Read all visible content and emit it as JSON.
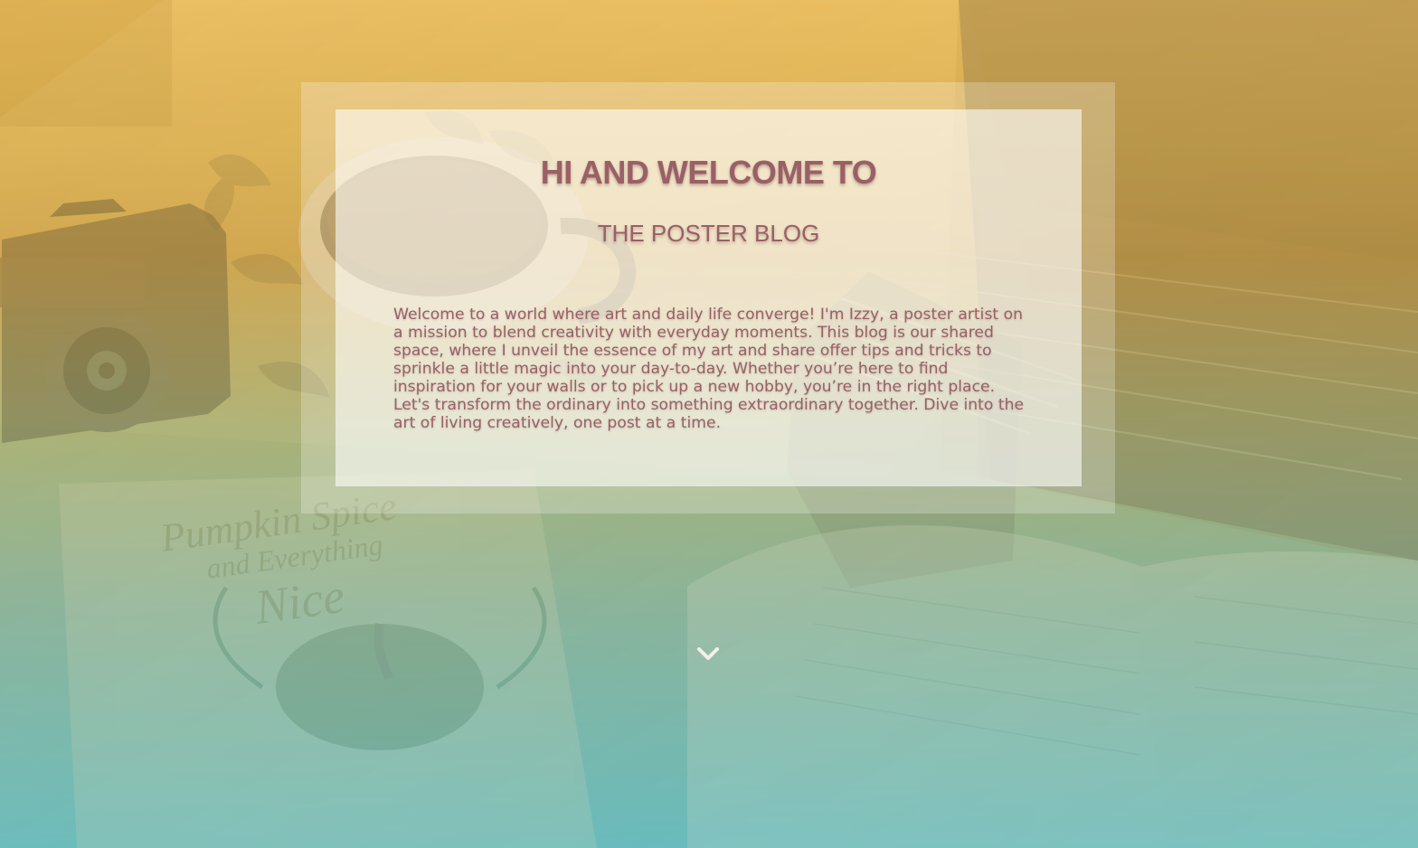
{
  "hero": {
    "heading": "HI AND WELCOME TO",
    "subheading": "THE POSTER BLOG",
    "intro_text": "Welcome to a world where art and daily life converge! I'm Izzy, a poster artist on a mission to blend creativity with everyday moments. This blog is our shared space, where I unveil the essence of my art and share offer tips and tricks to sprinkle a little magic into your day-to-day. Whether you’re here to find inspiration for your walls or to pick up a new hobby, you’re in the right place. Let's transform the ordinary into something extraordinary together. Dive into the art of living creatively, one post at a time.",
    "background_image_text": [
      "Pumpkin Spice",
      "and Everything",
      "Nice"
    ],
    "scroll_icon": "chevron-down-icon"
  },
  "colors": {
    "gradient_top": "#e7b54c",
    "gradient_middle": "#9fab6e",
    "gradient_bottom": "#5fb7b9",
    "text_accent": "#9b5f66"
  }
}
